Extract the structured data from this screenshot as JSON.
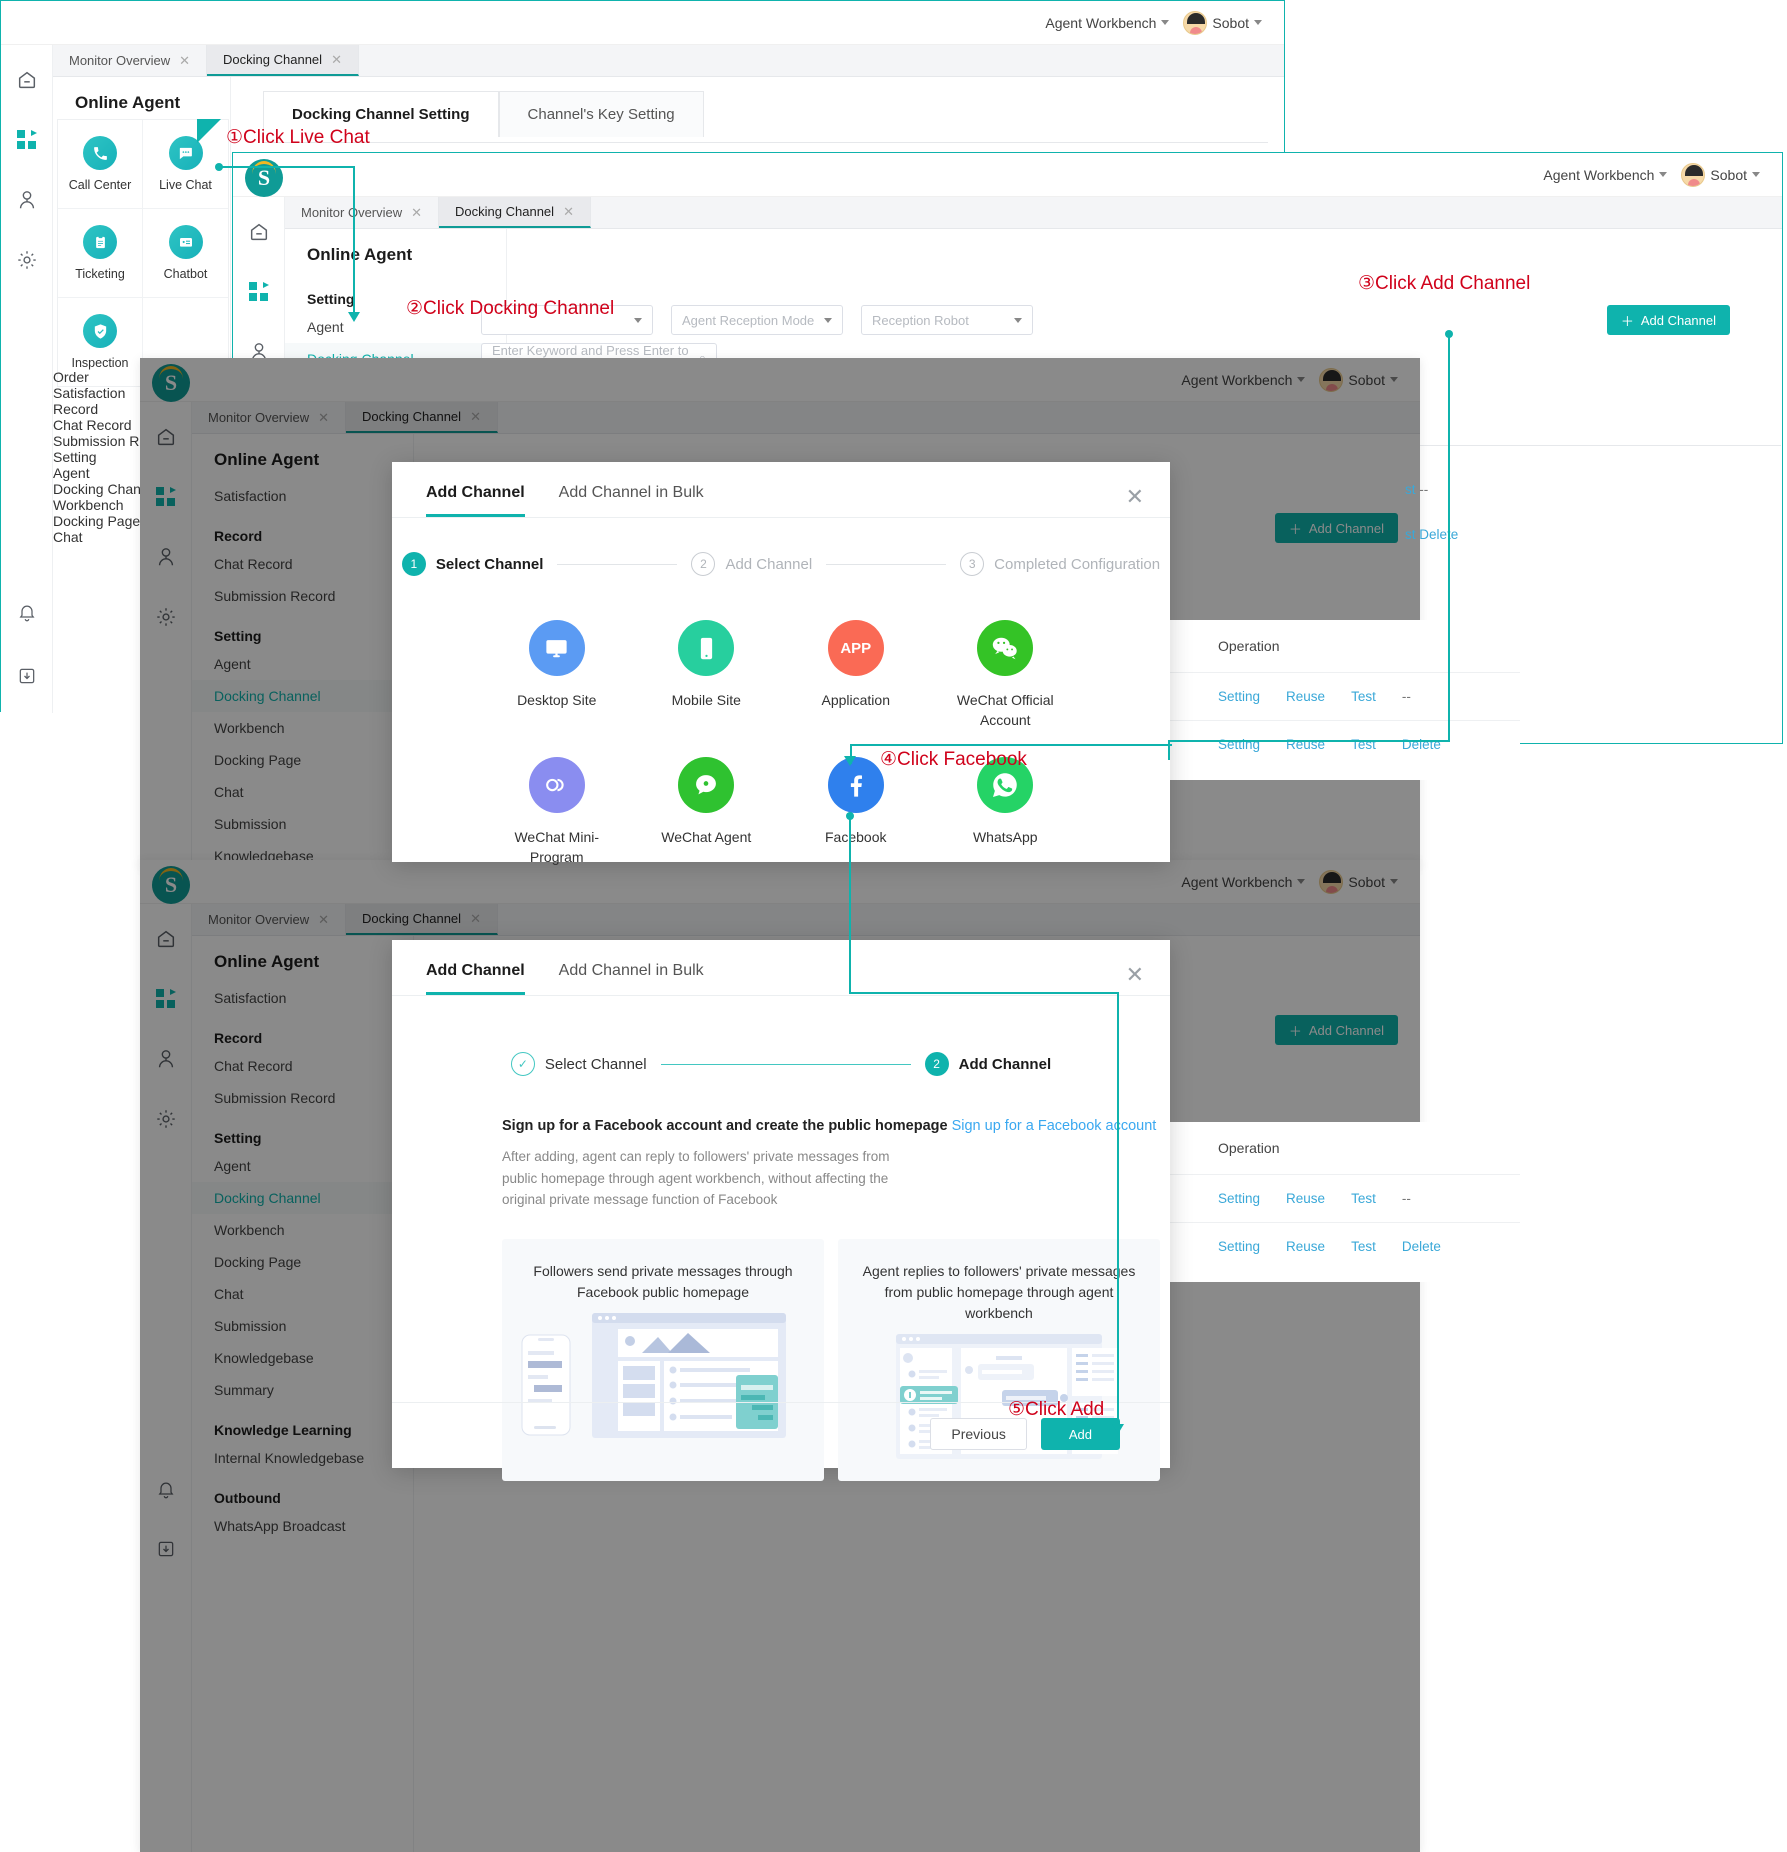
{
  "brand": {
    "accent": "#0fb3ad",
    "accent_dark": "#0f9b96",
    "logo_letter": "S",
    "annotation_color": "#d0021b"
  },
  "header": {
    "workbench_label": "Agent Workbench",
    "user_label": "Sobot"
  },
  "tabs": [
    {
      "label": "Monitor Overview",
      "active": false
    },
    {
      "label": "Docking Channel",
      "active": true
    }
  ],
  "window1": {
    "nav_title": "Online Agent",
    "apps": [
      {
        "label": "Call Center",
        "icon": "phone-icon"
      },
      {
        "label": "Live Chat",
        "icon": "chat-bubble-icon"
      },
      {
        "label": "Ticketing",
        "icon": "clipboard-icon"
      },
      {
        "label": "Chatbot",
        "icon": "robot-icon"
      },
      {
        "label": "Inspection",
        "icon": "shield-check-icon"
      }
    ],
    "nav_items": [
      {
        "label": "Order",
        "type": "item"
      },
      {
        "label": "Satisfaction",
        "type": "item"
      },
      {
        "label": "Record",
        "type": "group"
      },
      {
        "label": "Chat Record",
        "type": "item"
      },
      {
        "label": "Submission R",
        "type": "item"
      },
      {
        "label": "Setting",
        "type": "group"
      },
      {
        "label": "Agent",
        "type": "item"
      },
      {
        "label": "Docking Chan",
        "type": "item",
        "active": true
      },
      {
        "label": "Workbench",
        "type": "item"
      },
      {
        "label": "Docking Page",
        "type": "item"
      },
      {
        "label": "Chat",
        "type": "item"
      }
    ],
    "content_tabs": [
      {
        "label": "Docking Channel Setting",
        "active": true
      },
      {
        "label": "Channel's Key Setting",
        "active": false
      }
    ]
  },
  "window2": {
    "nav_title": "Online Agent",
    "nav_items": [
      {
        "label": "Setting",
        "type": "group"
      },
      {
        "label": "Agent",
        "type": "item"
      },
      {
        "label": "Docking Channel",
        "type": "item",
        "active": true
      }
    ],
    "content_tabs": [
      {
        "label": "Docking Channel Setting",
        "active": true
      },
      {
        "label": "Channel's Key Setting",
        "active": false
      }
    ],
    "filters": [
      {
        "placeholder": ""
      },
      {
        "placeholder": "Agent Reception Mode"
      },
      {
        "placeholder": "Reception Robot"
      }
    ],
    "search_placeholder": "Enter Keyword and Press Enter to ...",
    "add_channel_label": "Add Channel"
  },
  "window3": {
    "nav_title": "Online Agent",
    "nav_items": [
      {
        "label": "Satisfaction",
        "type": "item"
      },
      {
        "label": "Record",
        "type": "group"
      },
      {
        "label": "Chat Record",
        "type": "item"
      },
      {
        "label": "Submission Record",
        "type": "item"
      },
      {
        "label": "Setting",
        "type": "group"
      },
      {
        "label": "Agent",
        "type": "item"
      },
      {
        "label": "Docking Channel",
        "type": "item",
        "active": true
      },
      {
        "label": "Workbench",
        "type": "item"
      },
      {
        "label": "Docking Page",
        "type": "item"
      },
      {
        "label": "Chat",
        "type": "item"
      },
      {
        "label": "Submission",
        "type": "item"
      },
      {
        "label": "Knowledgebase",
        "type": "item"
      }
    ],
    "add_channel_label": "Add Channel",
    "table": {
      "operation_header": "Operation",
      "rows": [
        {
          "actions": [
            "Setting",
            "Reuse",
            "Test",
            "--"
          ]
        },
        {
          "actions": [
            "Setting",
            "Reuse",
            "Test",
            "Delete"
          ]
        }
      ]
    }
  },
  "window4": {
    "nav_title": "Online Agent",
    "nav_items": [
      {
        "label": "Satisfaction",
        "type": "item"
      },
      {
        "label": "Record",
        "type": "group"
      },
      {
        "label": "Chat Record",
        "type": "item"
      },
      {
        "label": "Submission Record",
        "type": "item"
      },
      {
        "label": "Setting",
        "type": "group"
      },
      {
        "label": "Agent",
        "type": "item"
      },
      {
        "label": "Docking Channel",
        "type": "item",
        "active": true
      },
      {
        "label": "Workbench",
        "type": "item"
      },
      {
        "label": "Docking Page",
        "type": "item"
      },
      {
        "label": "Chat",
        "type": "item"
      },
      {
        "label": "Submission",
        "type": "item"
      },
      {
        "label": "Knowledgebase",
        "type": "item"
      },
      {
        "label": "Summary",
        "type": "item"
      },
      {
        "label": "Knowledge Learning",
        "type": "group"
      },
      {
        "label": "Internal Knowledgebase",
        "type": "item"
      },
      {
        "label": "Outbound",
        "type": "group"
      },
      {
        "label": "WhatsApp Broadcast",
        "type": "item"
      }
    ],
    "add_channel_label": "Add Channel",
    "table": {
      "operation_header": "Operation",
      "rows": [
        {
          "actions": [
            "Setting",
            "Reuse",
            "Test",
            "--"
          ]
        },
        {
          "actions": [
            "Setting",
            "Reuse",
            "Test",
            "Delete"
          ]
        }
      ]
    }
  },
  "modal_step1": {
    "tabs": [
      {
        "label": "Add Channel",
        "active": true
      },
      {
        "label": "Add Channel in Bulk",
        "active": false
      }
    ],
    "close_icon": "close-icon",
    "steps": [
      {
        "num": "1",
        "label": "Select Channel",
        "state": "on"
      },
      {
        "num": "2",
        "label": "Add Channel",
        "state": "off"
      },
      {
        "num": "3",
        "label": "Completed Configuration",
        "state": "off"
      }
    ],
    "channels": [
      {
        "label": "Desktop Site",
        "icon": "desktop-monitor-icon",
        "color": "#5b9bf3"
      },
      {
        "label": "Mobile Site",
        "icon": "mobile-phone-icon",
        "color": "#27cf9e"
      },
      {
        "label": "Application",
        "icon": "app-icon",
        "color": "#fa6a55",
        "text": "APP"
      },
      {
        "label": "WeChat Official Account",
        "icon": "wechat-icon",
        "color": "#34c326"
      },
      {
        "label": "WeChat Mini-Program",
        "icon": "wechat-mini-program-icon",
        "color": "#8a8df0"
      },
      {
        "label": "WeChat Agent",
        "icon": "wechat-agent-icon",
        "color": "#2fc230"
      },
      {
        "label": "Facebook",
        "icon": "facebook-icon",
        "color": "#2f80ed"
      },
      {
        "label": "WhatsApp",
        "icon": "whatsapp-icon",
        "color": "#25d366"
      }
    ]
  },
  "modal_step2": {
    "tabs": [
      {
        "label": "Add Channel",
        "active": true
      },
      {
        "label": "Add Channel in Bulk",
        "active": false
      }
    ],
    "close_icon": "close-icon",
    "steps": [
      {
        "num": "check",
        "label": "Select Channel",
        "state": "done"
      },
      {
        "num": "2",
        "label": "Add Channel",
        "state": "on"
      }
    ],
    "signup_text": "Sign up for a Facebook account and create the public homepage",
    "signup_link": "Sign up for a Facebook account",
    "description": "After adding, agent can reply to followers' private messages from public homepage through agent workbench, without affecting the original private message function of Facebook",
    "cards": [
      {
        "caption": "Followers send private messages through Facebook public homepage"
      },
      {
        "caption": "Agent replies to followers' private messages from public homepage through agent workbench"
      }
    ],
    "previous_label": "Previous",
    "add_label": "Add"
  },
  "annotations": [
    {
      "num": "①",
      "text": "Click Live Chat"
    },
    {
      "num": "②",
      "text": "Click Docking Channel"
    },
    {
      "num": "③",
      "text": "Click Add Channel"
    },
    {
      "num": "④",
      "text": "Click Facebook"
    },
    {
      "num": "⑤",
      "text": "Click Add"
    }
  ]
}
